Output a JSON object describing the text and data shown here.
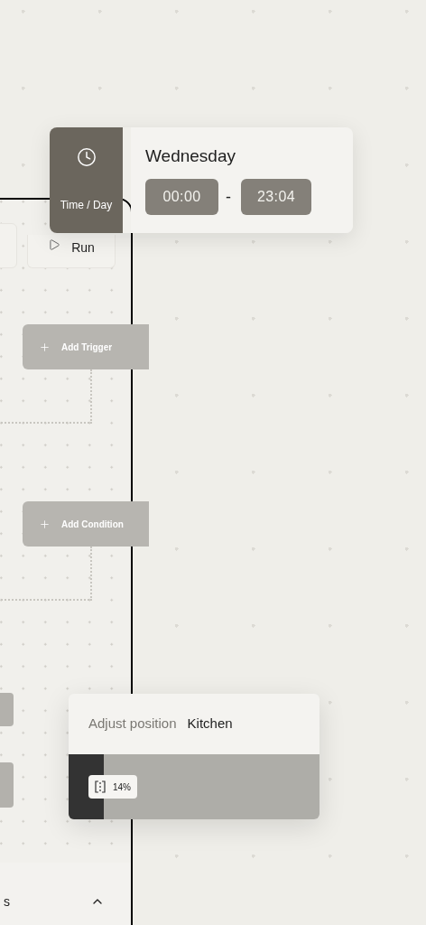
{
  "time_card": {
    "label": "Time / Day",
    "day": "Wednesday",
    "start": "00:00",
    "separator": "-",
    "end": "23:04"
  },
  "panel": {
    "run_button": "Run",
    "add_buttons": [
      {
        "label": "Add Trigger"
      },
      {
        "label": "Add Condition"
      }
    ],
    "footer_label": "s"
  },
  "position_card": {
    "title": "Adjust position",
    "room": "Kitchen",
    "level": 0.14,
    "reading": "14%"
  }
}
